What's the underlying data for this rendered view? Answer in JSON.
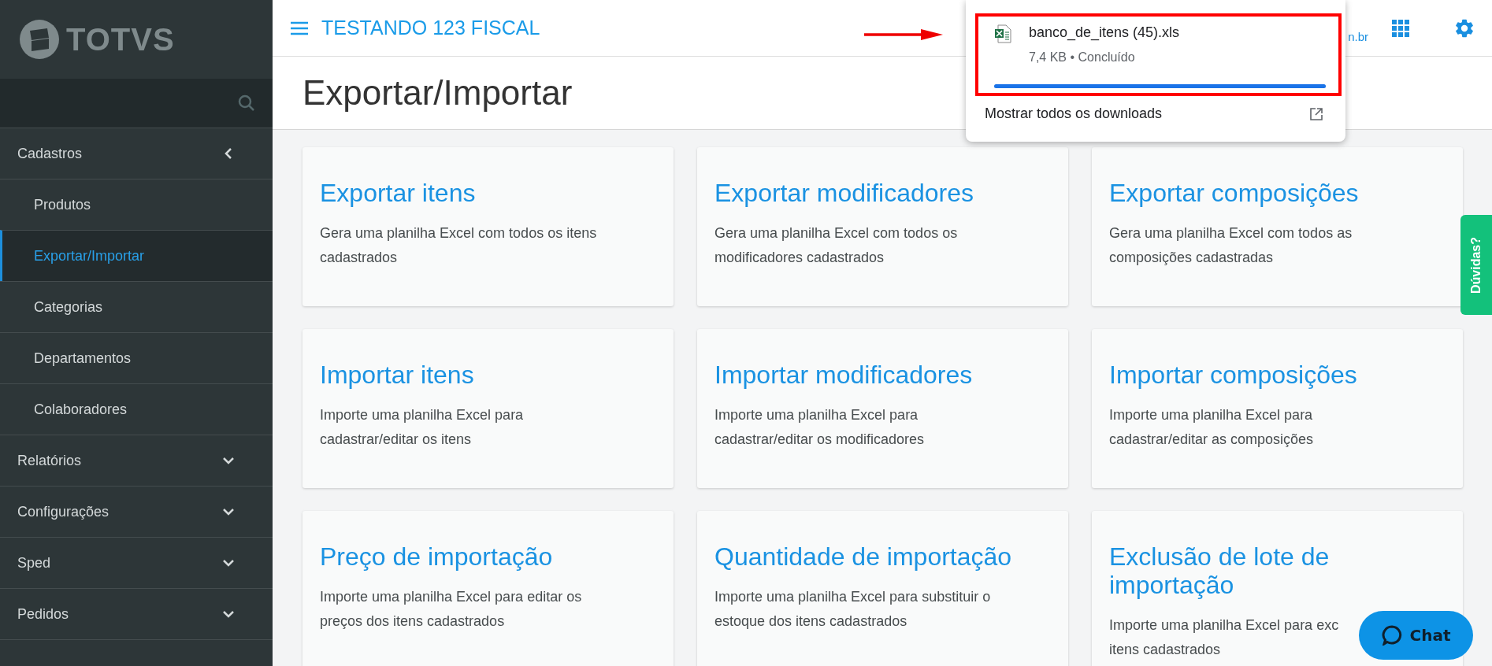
{
  "logo": "TOTVS",
  "header": {
    "title": "TESTANDO 123 FISCAL",
    "link": "n.br"
  },
  "sidebar": {
    "items": [
      {
        "label": "Cadastros",
        "expanded": true,
        "children": [
          {
            "label": "Produtos",
            "selected": false
          },
          {
            "label": "Exportar/Importar",
            "selected": true
          },
          {
            "label": "Categorias",
            "selected": false
          },
          {
            "label": "Departamentos",
            "selected": false
          },
          {
            "label": "Colaboradores",
            "selected": false
          }
        ]
      },
      {
        "label": "Relatórios",
        "expanded": false
      },
      {
        "label": "Configurações",
        "expanded": false
      },
      {
        "label": "Sped",
        "expanded": false
      },
      {
        "label": "Pedidos",
        "expanded": false
      }
    ]
  },
  "page_title": "Exportar/Importar",
  "cards": [
    {
      "title": "Exportar itens",
      "description": [
        "Gera uma planilha Excel com todos os itens",
        "cadastrados"
      ]
    },
    {
      "title": "Exportar modificadores",
      "description": [
        "Gera uma planilha Excel com todos os",
        "modificadores cadastrados"
      ]
    },
    {
      "title": "Exportar composições",
      "description": [
        "Gera uma planilha Excel com todos as",
        "composições cadastradas"
      ]
    },
    {
      "title": "Importar itens",
      "description": [
        "Importe uma planilha Excel para",
        "cadastrar/editar os itens"
      ]
    },
    {
      "title": "Importar modificadores",
      "description": [
        "Importe uma planilha Excel para",
        "cadastrar/editar os modificadores"
      ]
    },
    {
      "title": "Importar composições",
      "description": [
        "Importe uma planilha Excel para",
        "cadastrar/editar as composições"
      ]
    },
    {
      "title": "Preço de importação",
      "description": [
        "Importe uma planilha Excel para editar os",
        "preços dos itens cadastrados"
      ]
    },
    {
      "title": "Quantidade de importação",
      "description": [
        "Importe uma planilha Excel para substituir o",
        "estoque dos itens cadastrados"
      ]
    },
    {
      "title": "Exclusão de lote de importação",
      "description": [
        "Importe uma planilha Excel para exc",
        "itens cadastrados"
      ]
    }
  ],
  "download_popup": {
    "file_name": "banco_de_itens (45).xls",
    "details": "7,4 KB • Concluído",
    "level": 1,
    "show_all": "Mostrar todos os downloads"
  },
  "help_tab": "Dúvidas?",
  "chat_button": "Chat"
}
